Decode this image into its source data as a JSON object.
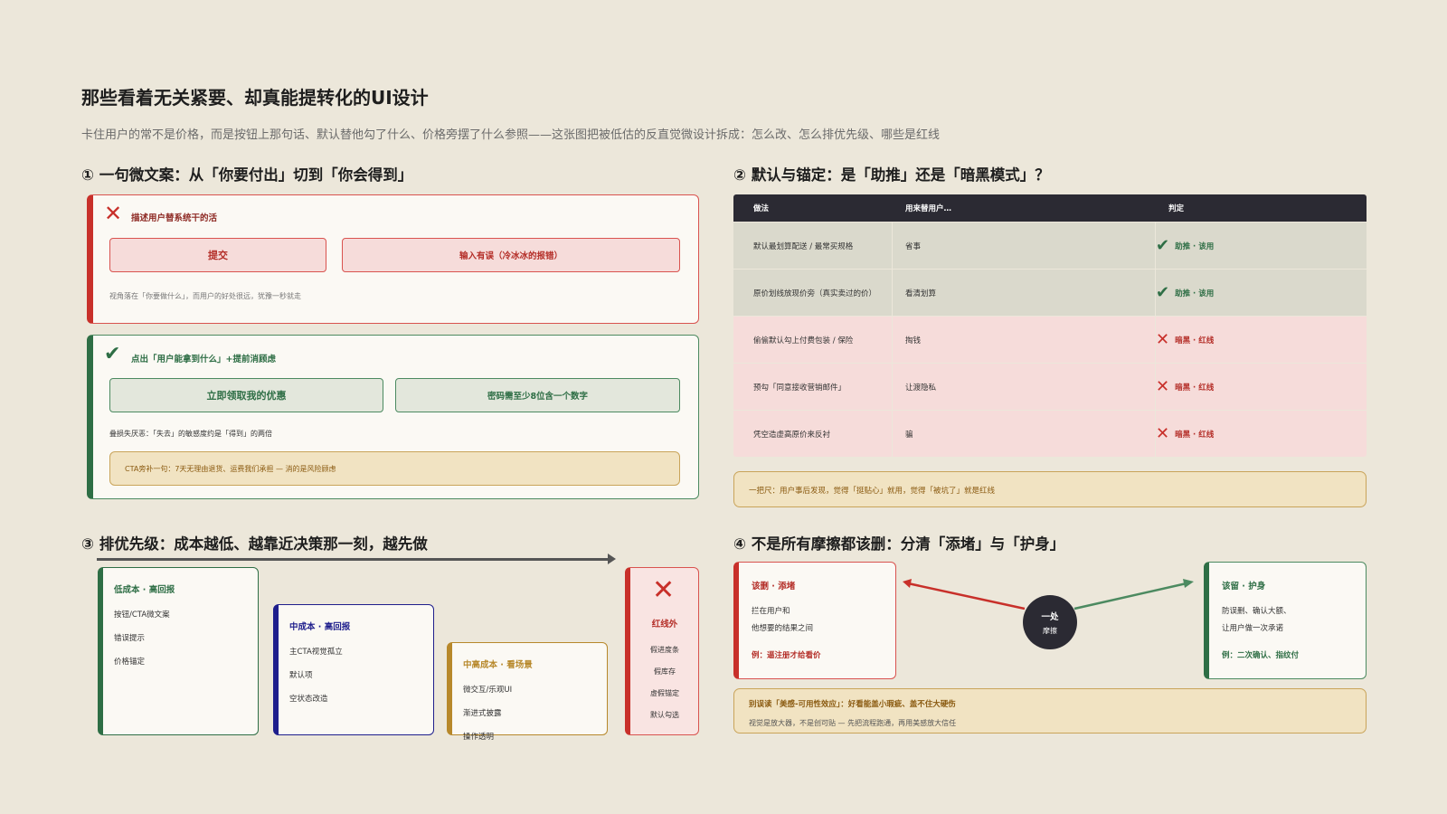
{
  "header": {
    "title": "那些看着无关紧要、却真能提转化的UI设计",
    "subtitle": "卡住用户的常不是价格，而是按钮上那句话、默认替他勾了什么、价格旁摆了什么参照——这张图把被低估的反直觉微设计拆成：怎么改、怎么排优先级、哪些是红线"
  },
  "section1": {
    "title": "① 一句微文案：从「你要付出」切到「你会得到」",
    "bad": {
      "icon": "x-icon",
      "label": "描述用户替系统干的活",
      "button1": "提交",
      "button2": "输入有误（冷冰冰的报错）",
      "note": "视角落在「你要做什么」，而用户的好处很远，犹豫一秒就走"
    },
    "good": {
      "icon": "check-icon",
      "label": "点出「用户能拿到什么」+提前消顾虑",
      "button1": "立即领取我的优惠",
      "button2": "密码需至少8位含一个数字",
      "note": "叠损失厌恶：「失去」的敏感度约是「得到」的两倍",
      "callout": "CTA旁补一句：7天无理由退货、运费我们承担 — 消的是风险顾虑"
    }
  },
  "section2": {
    "title": "② 默认与锚定：是「助推」还是「暗黑模式」？",
    "columns": [
      "做法",
      "用来替用户…",
      "判定"
    ],
    "rows": [
      {
        "practice": "默认最划算配送 / 最常买规格",
        "purpose": "省事",
        "verdict": "助推 · 该用",
        "type": "good"
      },
      {
        "practice": "原价划线放现价旁（真实卖过的价）",
        "purpose": "看清划算",
        "verdict": "助推 · 该用",
        "type": "good"
      },
      {
        "practice": "偷偷默认勾上付费包装 / 保险",
        "purpose": "掏钱",
        "verdict": "暗黑 · 红线",
        "type": "bad"
      },
      {
        "practice": "预勾「同意接收营销邮件」",
        "purpose": "让渡隐私",
        "verdict": "暗黑 · 红线",
        "type": "bad"
      },
      {
        "practice": "凭空造虚高原价来反衬",
        "purpose": "骗",
        "verdict": "暗黑 · 红线",
        "type": "bad"
      }
    ],
    "rule": "一把尺：用户事后发现，觉得「挺贴心」就用，觉得「被坑了」就是红线"
  },
  "section3": {
    "title": "③ 排优先级：成本越低、越靠近决策那一刻，越先做",
    "tiers": [
      {
        "title": "低成本 · 高回报",
        "items": [
          "按钮/CTA微文案",
          "错误提示",
          "价格锚定"
        ],
        "color": "#2E6E45"
      },
      {
        "title": "中成本 · 高回报",
        "items": [
          "主CTA视觉孤立",
          "默认项",
          "空状态改造"
        ],
        "color": "#1E1E8C"
      },
      {
        "title": "中高成本 · 看场景",
        "items": [
          "微交互/乐观UI",
          "渐进式披露",
          "操作透明"
        ],
        "color": "#B7882A"
      }
    ],
    "redline": {
      "title": "红线外",
      "items": [
        "假进度条",
        "假库存",
        "虚假锚定",
        "默认勾选"
      ]
    }
  },
  "section4": {
    "title": "④ 不是所有摩擦都该删：分清「添堵」与「护身」",
    "left": {
      "title": "该删 · 添堵",
      "lines": [
        "拦在用户和",
        "他想要的结果之间"
      ],
      "example": "例：逼注册才给看价"
    },
    "center": {
      "line1": "一处",
      "line2": "摩擦"
    },
    "right": {
      "title": "该留 · 护身",
      "lines": [
        "防误删、确认大额、",
        "让用户做一次承诺"
      ],
      "example": "例：二次确认、指纹付"
    },
    "note_title": "别误读「美感-可用性效应」：好看能盖小瑕疵、盖不住大硬伤",
    "note_body": "视觉是放大器，不是创可贴 — 先把流程跑通，再用美感放大信任"
  },
  "colors": {
    "red": "#C8302A",
    "green": "#2E6E45",
    "navy": "#1E1E8C",
    "amber": "#B7882A",
    "dark": "#2B2A33"
  }
}
